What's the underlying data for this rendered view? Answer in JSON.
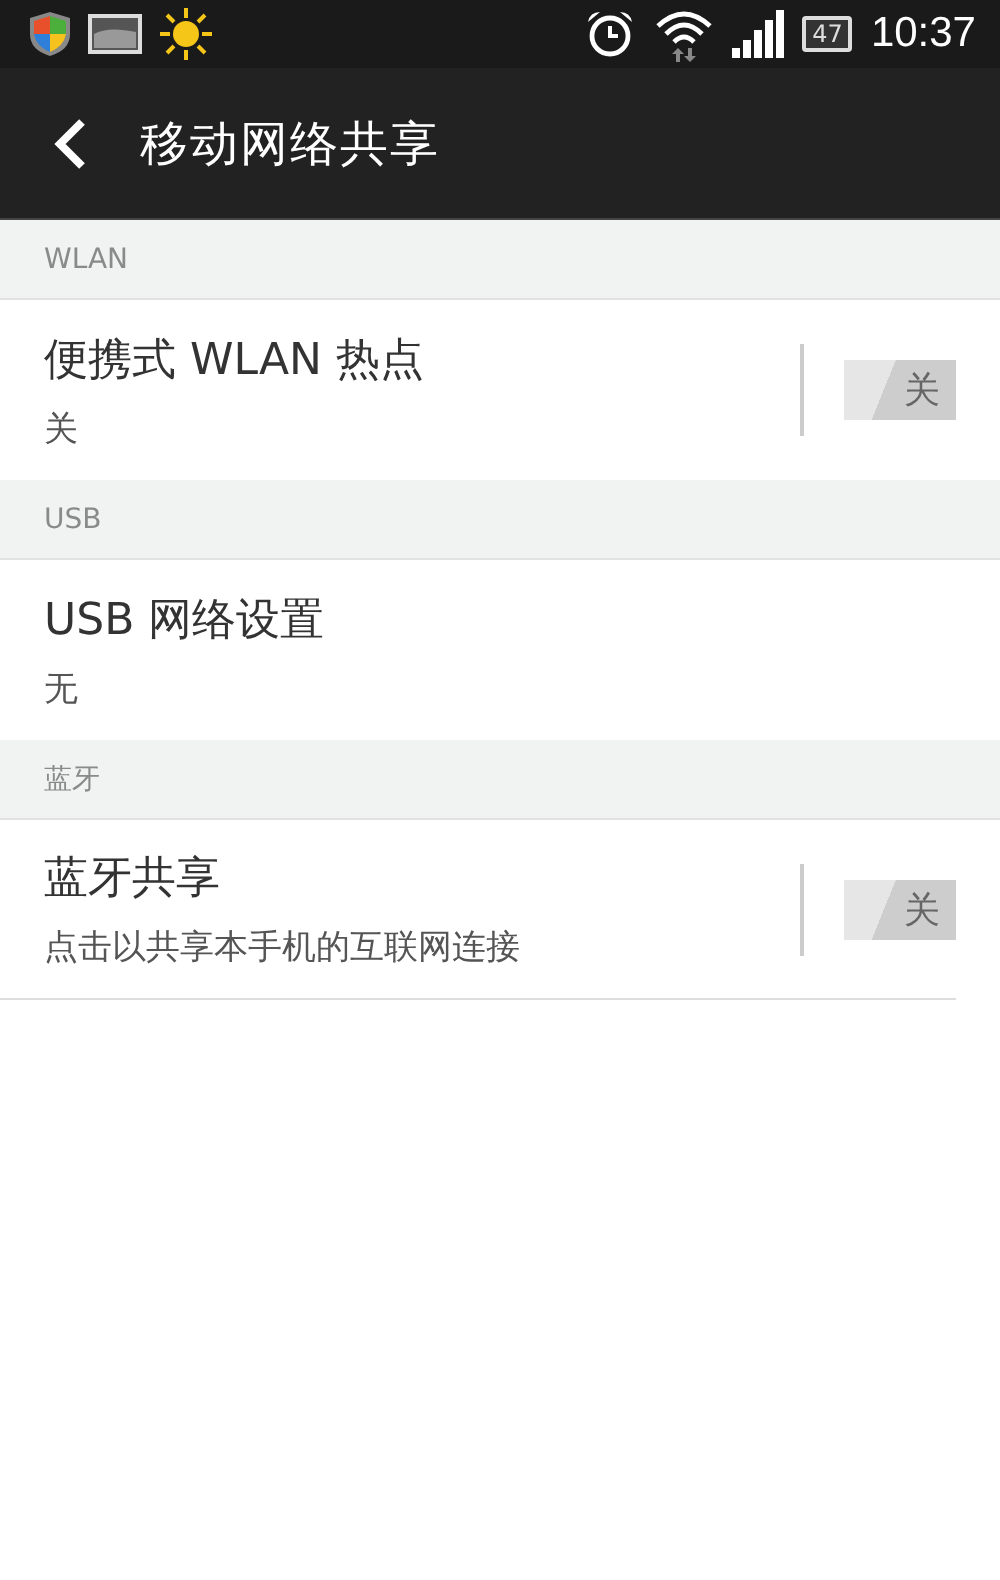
{
  "status_bar": {
    "battery": "47",
    "time": "10:37"
  },
  "title_bar": {
    "title": "移动网络共享"
  },
  "sections": [
    {
      "header": "WLAN",
      "items": [
        {
          "kind": "switch",
          "title": "便携式 WLAN 热点",
          "subtitle": "关",
          "on": false,
          "switch_label": "关"
        }
      ]
    },
    {
      "header": "USB",
      "items": [
        {
          "kind": "plain",
          "title": "USB 网络设置",
          "subtitle": "无"
        }
      ]
    },
    {
      "header": "蓝牙",
      "items": [
        {
          "kind": "switch",
          "title": "蓝牙共享",
          "subtitle": "点击以共享本手机的互联网连接",
          "on": false,
          "switch_label": "关"
        }
      ]
    }
  ]
}
